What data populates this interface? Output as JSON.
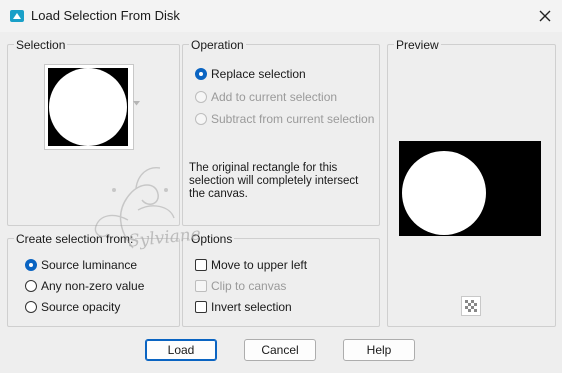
{
  "window": {
    "title": "Load Selection From Disk"
  },
  "selection": {
    "title": "Selection"
  },
  "operation": {
    "title": "Operation",
    "options": [
      {
        "label": "Replace selection",
        "checked": true,
        "enabled": true
      },
      {
        "label": "Add to current selection",
        "checked": false,
        "enabled": false
      },
      {
        "label": "Subtract from current selection",
        "checked": false,
        "enabled": false
      }
    ],
    "message": "The original rectangle for this selection will completely intersect the canvas."
  },
  "preview": {
    "title": "Preview"
  },
  "create_from": {
    "title": "Create selection from:",
    "options": [
      {
        "label": "Source luminance",
        "checked": true
      },
      {
        "label": "Any non-zero value",
        "checked": false
      },
      {
        "label": "Source opacity",
        "checked": false
      }
    ]
  },
  "options": {
    "title": "Options",
    "items": [
      {
        "label": "Move to upper left",
        "checked": false,
        "enabled": true
      },
      {
        "label": "Clip to canvas",
        "checked": false,
        "enabled": false
      },
      {
        "label": "Invert selection",
        "checked": false,
        "enabled": true
      }
    ]
  },
  "buttons": {
    "load": "Load",
    "cancel": "Cancel",
    "help": "Help"
  },
  "watermark": {
    "text": "Sylviane"
  },
  "colors": {
    "accent": "#0a64c2",
    "app_icon": "#1aa0c8"
  }
}
